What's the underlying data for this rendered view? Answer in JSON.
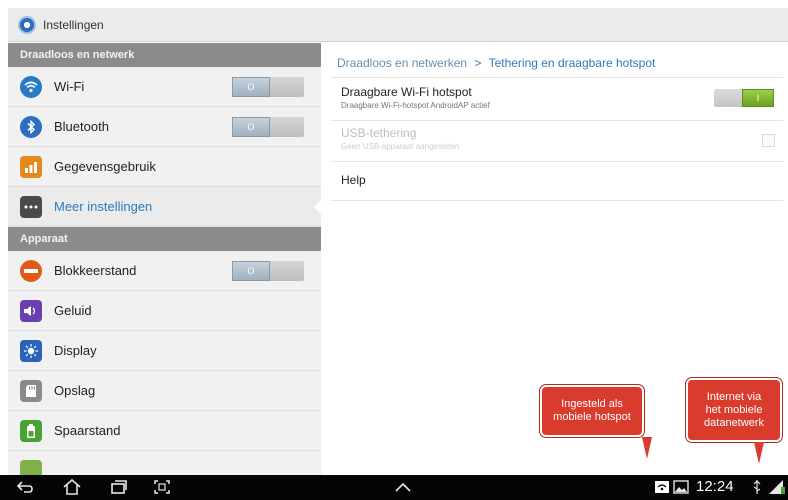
{
  "header": {
    "title": "Instellingen",
    "icon": "settings-gear-icon"
  },
  "sidebar": {
    "sections": [
      {
        "label": "Draadloos en netwerk"
      },
      {
        "label": "Apparaat"
      }
    ],
    "items": [
      {
        "label": "Wi-Fi",
        "icon": "wifi-icon",
        "toggle": "O",
        "color": "#2a7bc1"
      },
      {
        "label": "Bluetooth",
        "icon": "bluetooth-icon",
        "toggle": "O",
        "color": "#2a6fc0"
      },
      {
        "label": "Gegevensgebruik",
        "icon": "data-usage-icon",
        "color": "#e58a1a"
      },
      {
        "label": "Meer instellingen",
        "icon": "more-icon",
        "color": "#4a4a4a"
      },
      {
        "label": "Blokkeerstand",
        "icon": "block-icon",
        "toggle": "O",
        "color": "#e15a1b"
      },
      {
        "label": "Geluid",
        "icon": "sound-icon",
        "color": "#6a3fb2"
      },
      {
        "label": "Display",
        "icon": "display-icon",
        "color": "#2b63b8"
      },
      {
        "label": "Opslag",
        "icon": "storage-icon",
        "color": "#8a8a8a"
      },
      {
        "label": "Spaarstand",
        "icon": "battery-saver-icon",
        "color": "#4aa234"
      }
    ]
  },
  "content": {
    "breadcrumb": {
      "parent": "Draadloos en netwerken",
      "separator": ">",
      "current": "Tethering en draagbare hotspot"
    },
    "prefs": [
      {
        "title": "Draagbare Wi-Fi hotspot",
        "subtitle": "Draagbare Wi-Fi-hotspot AndroidAP actief",
        "toggle": "I",
        "enabled": true
      },
      {
        "title": "USB-tethering",
        "subtitle": "Geen USB-apparaat aangesloten",
        "enabled": false
      },
      {
        "title": "Help",
        "enabled": true
      }
    ]
  },
  "annotations": {
    "hotspot": [
      "Ingesteld als",
      "mobiele hotspot"
    ],
    "network": [
      "Internet via",
      "het mobiele",
      "datanetwerk"
    ]
  },
  "navbar": {
    "time": "12:24",
    "buttons": [
      "back-icon",
      "home-icon",
      "recent-apps-icon",
      "screenshot-icon",
      "up-chevron-icon"
    ],
    "status_icons": [
      "hotspot-status-icon",
      "gallery-icon",
      "usb-icon",
      "signal-icon"
    ]
  }
}
